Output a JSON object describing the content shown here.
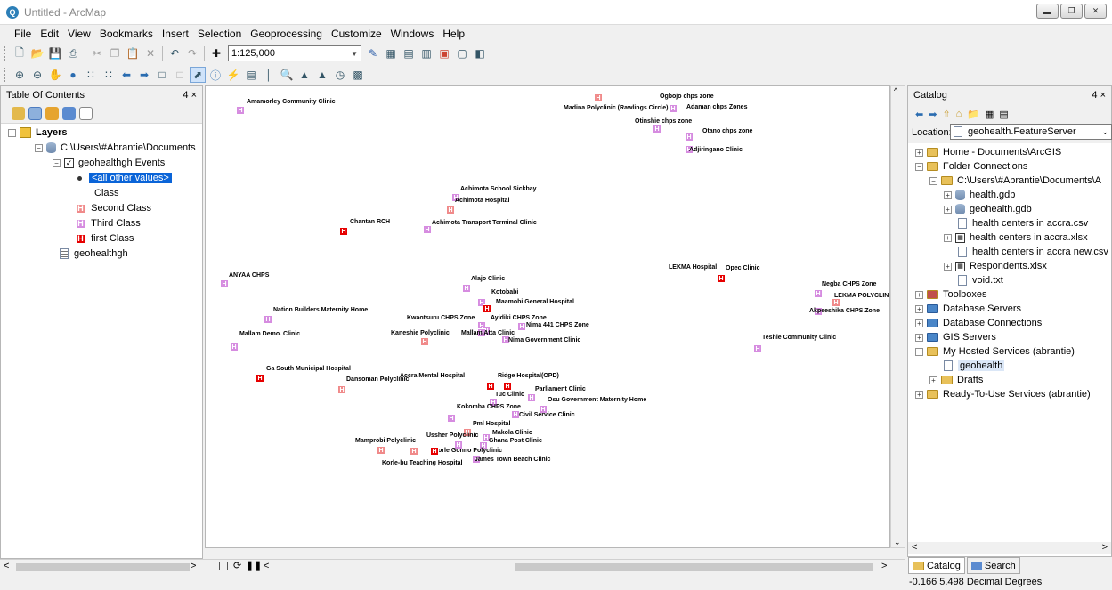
{
  "window": {
    "title": "Untitled - ArcMap"
  },
  "menu": [
    "File",
    "Edit",
    "View",
    "Bookmarks",
    "Insert",
    "Selection",
    "Geoprocessing",
    "Customize",
    "Windows",
    "Help"
  ],
  "toolbar": {
    "scale": "1:125,000"
  },
  "toc": {
    "title": "Table Of Contents",
    "pin": "4 ×",
    "layers_label": "Layers",
    "path": "C:\\Users\\#Abrantie\\Documents",
    "layer_name": "geohealthgh Events",
    "all_other": "<all other values>",
    "class_label": "Class",
    "classes": [
      "Second Class",
      "Third Class",
      "first Class"
    ],
    "table_name": "geohealthgh"
  },
  "catalog": {
    "title": "Catalog",
    "location_label": "Location:",
    "location_value": "geohealth.FeatureServer",
    "items": [
      {
        "label": "Home - Documents\\ArcGIS"
      },
      {
        "label": "Folder Connections"
      },
      {
        "label": "C:\\Users\\#Abrantie\\Documents\\A"
      },
      {
        "label": "health.gdb"
      },
      {
        "label": "geohealth.gdb"
      },
      {
        "label": "health centers in accra.csv"
      },
      {
        "label": "health centers in accra.xlsx"
      },
      {
        "label": "health centers in accra new.csv"
      },
      {
        "label": "Respondents.xlsx"
      },
      {
        "label": "void.txt"
      },
      {
        "label": "Toolboxes"
      },
      {
        "label": "Database Servers"
      },
      {
        "label": "Database Connections"
      },
      {
        "label": "GIS Servers"
      },
      {
        "label": "My Hosted Services (abrantie)"
      },
      {
        "label": "geohealth"
      },
      {
        "label": "Drafts"
      },
      {
        "label": "Ready-To-Use Services (abrantie)"
      }
    ],
    "tab_catalog": "Catalog",
    "tab_search": "Search"
  },
  "status": {
    "coords": "-0.166  5.498 Decimal Degrees"
  },
  "map": {
    "points": [
      {
        "label": "Amamorley Community Clinic",
        "cls": "third"
      },
      {
        "label": "Ogbojo chps zone",
        "cls": "third"
      },
      {
        "label": "Madina Polyclinic (Rawlings Circle)",
        "cls": "second"
      },
      {
        "label": "Adaman chps Zones",
        "cls": "third"
      },
      {
        "label": "Otinshie chps zone",
        "cls": "third"
      },
      {
        "label": "Otano chps zone",
        "cls": "third"
      },
      {
        "label": "Adjiringano Clinic",
        "cls": "third"
      },
      {
        "label": "Achimota School Sickbay",
        "cls": "third"
      },
      {
        "label": "Achimota Hospital",
        "cls": "second"
      },
      {
        "label": "Chantan RCH",
        "cls": "first"
      },
      {
        "label": "Achimota Transport Terminal Clinic",
        "cls": "third"
      },
      {
        "label": "ANYAA CHPS",
        "cls": "third"
      },
      {
        "label": "LEKMA Hospital",
        "cls": "first"
      },
      {
        "label": "Opec Clinic",
        "cls": "first"
      },
      {
        "label": "Alajo Clinic",
        "cls": "third"
      },
      {
        "label": "Kotobabi",
        "cls": "third"
      },
      {
        "label": "Maamobi General Hospital",
        "cls": "first"
      },
      {
        "label": "Nation Builders Maternity Home",
        "cls": "third"
      },
      {
        "label": "Kwaotsuru CHPS Zone",
        "cls": "third"
      },
      {
        "label": "Ayidiki CHPS Zone",
        "cls": "third"
      },
      {
        "label": "Nima 441 CHPS Zone",
        "cls": "third"
      },
      {
        "label": "Negba CHPS Zone",
        "cls": "third"
      },
      {
        "label": "LEKMA POLYCLINIC",
        "cls": "second"
      },
      {
        "label": "Akpeeshika CHPS Zone",
        "cls": "third"
      },
      {
        "label": "Mallam Demo. Clinic",
        "cls": "third"
      },
      {
        "label": "Kaneshie Polyclinic",
        "cls": "second"
      },
      {
        "label": "Mallam Atta Clinic",
        "cls": "third"
      },
      {
        "label": "Nima Government Clinic",
        "cls": "third"
      },
      {
        "label": "Teshie Community Clinic",
        "cls": "third"
      },
      {
        "label": "Ga South Municipal Hospital",
        "cls": "first"
      },
      {
        "label": "Dansoman Polyclinic",
        "cls": "second"
      },
      {
        "label": "Accra Mental Hospital",
        "cls": "first"
      },
      {
        "label": "Ridge Hospital(OPD)",
        "cls": "first"
      },
      {
        "label": "Parliament Clinic",
        "cls": "third"
      },
      {
        "label": "Tuc Clinic",
        "cls": "third"
      },
      {
        "label": "Osu Government Maternity Home",
        "cls": "third"
      },
      {
        "label": "Kokomba CHPS Zone",
        "cls": "third"
      },
      {
        "label": "Civil Service Clinic",
        "cls": "third"
      },
      {
        "label": "Pml Hospital",
        "cls": "second"
      },
      {
        "label": "Makola Clinic",
        "cls": "third"
      },
      {
        "label": "Ussher Polyclinic",
        "cls": "third"
      },
      {
        "label": "Ghana Post Clinic",
        "cls": "third"
      },
      {
        "label": "Mamprobi Polyclinic",
        "cls": "second"
      },
      {
        "label": "Korle Gonno Polyclinic",
        "cls": "second"
      },
      {
        "label": "Korle-bu Teaching Hospital",
        "cls": "first"
      },
      {
        "label": "James Town Beach Clinic",
        "cls": "third"
      }
    ]
  }
}
